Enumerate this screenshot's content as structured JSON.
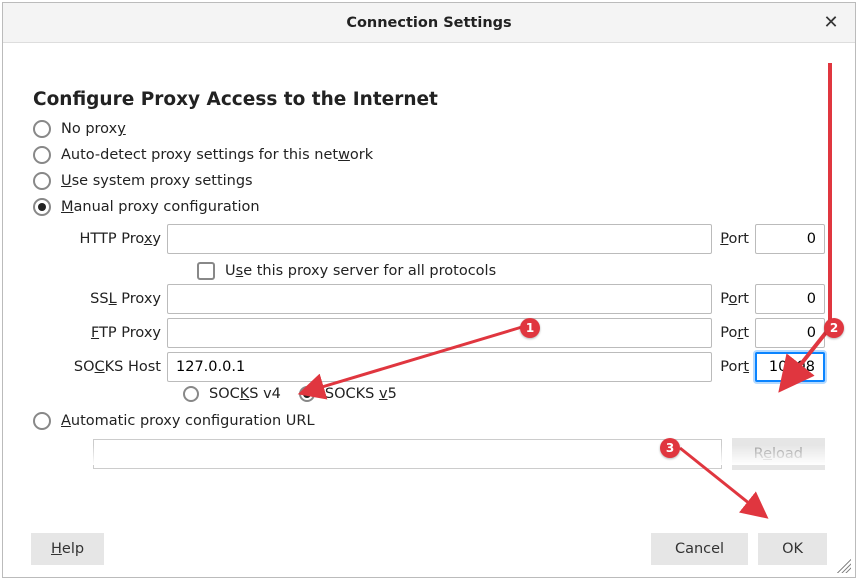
{
  "title": "Connection Settings",
  "heading": "Configure Proxy Access to the Internet",
  "options": {
    "no_proxy": "No proxy",
    "auto_detect": "Auto-detect proxy settings for this network",
    "use_system": "Use system proxy settings",
    "manual": "Manual proxy configuration",
    "auto_url": "Automatic proxy configuration URL"
  },
  "proxy": {
    "http_label": "HTTP Proxy",
    "http_host": "",
    "http_port": "0",
    "use_all_label": "Use this proxy server for all protocols",
    "ssl_label": "SSL Proxy",
    "ssl_host": "",
    "ssl_port": "0",
    "ftp_label": "FTP Proxy",
    "ftp_host": "",
    "ftp_port": "0",
    "socks_label": "SOCKS Host",
    "socks_host": "127.0.0.1",
    "socks_port": "10808",
    "port_label": "Port",
    "socks_v4": "SOCKS v4",
    "socks_v5": "SOCKS v5"
  },
  "auto_url": "",
  "buttons": {
    "reload": "Reload",
    "help": "Help",
    "cancel": "Cancel",
    "ok": "OK"
  },
  "annotations": {
    "n1": "1",
    "n2": "2",
    "n3": "3"
  }
}
